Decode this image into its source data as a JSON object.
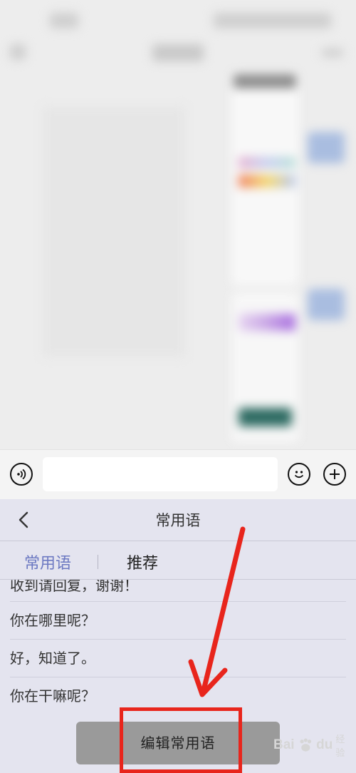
{
  "panel": {
    "title": "常用语",
    "tabs": [
      {
        "label": "常用语",
        "active": true
      },
      {
        "label": "推荐",
        "active": false
      }
    ],
    "phrases": [
      "收到请回复，谢谢！",
      "你在哪里呢？",
      "好，知道了。",
      "你在干嘛呢？"
    ],
    "edit_button": "编辑常用语"
  },
  "input_bar": {
    "voice_icon": "voice-icon",
    "emoji_icon": "emoji-icon",
    "plus_icon": "plus-icon"
  },
  "watermark": {
    "brand": "Bai",
    "brand_suffix": "du",
    "sub": "经验"
  },
  "colors": {
    "active_tab": "#6c79c2",
    "annotation": "#e8251c",
    "panel_bg": "#e4e4ef"
  }
}
